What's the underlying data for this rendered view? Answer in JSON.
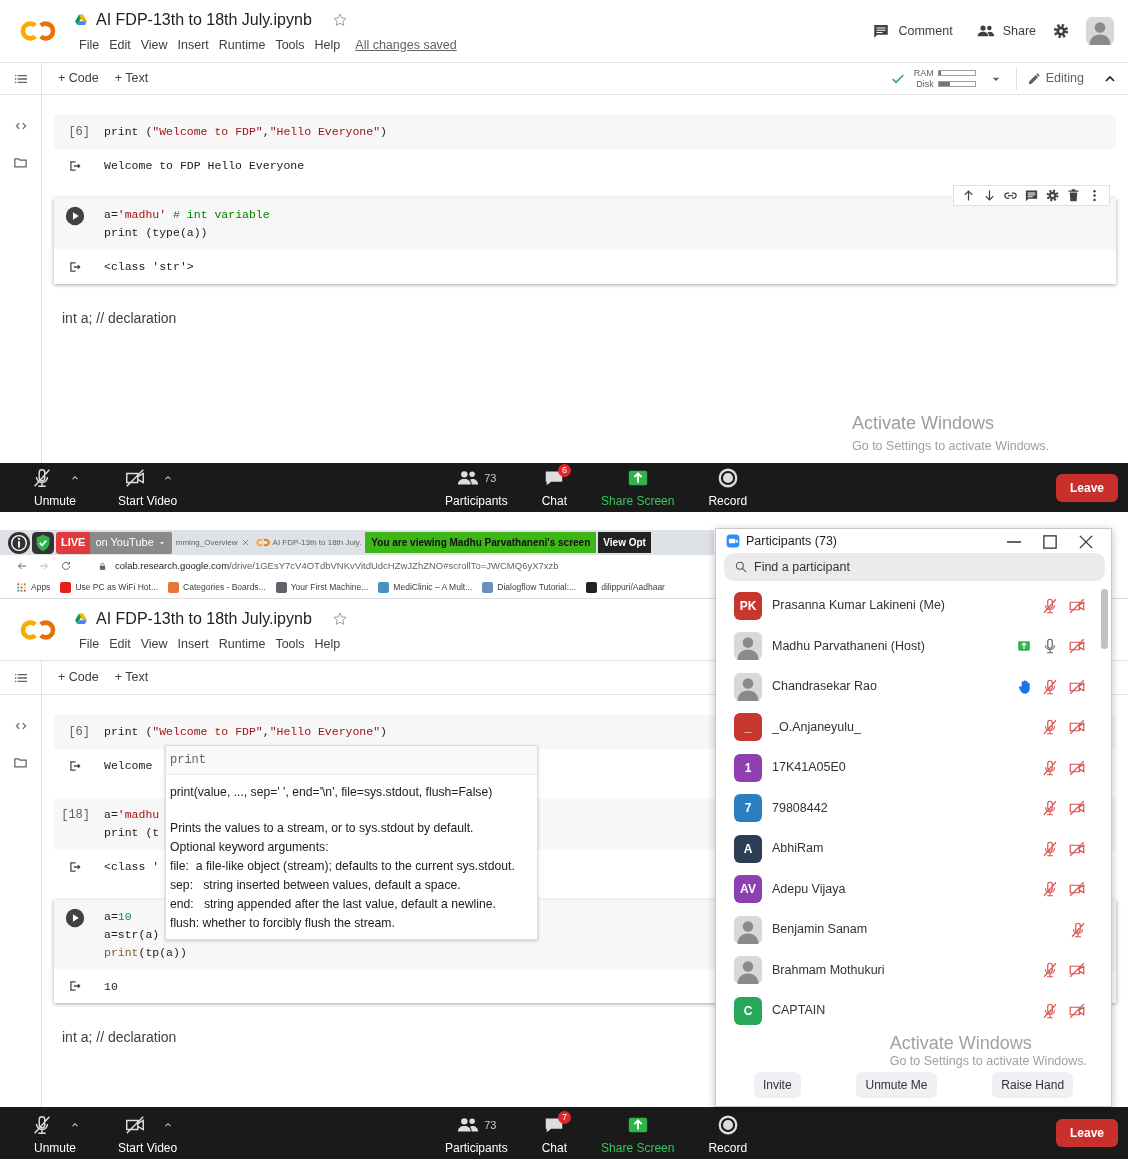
{
  "top_screen": {
    "notebook": {
      "title": "AI FDP-13th to 18th July.ipynb",
      "menu": [
        "File",
        "Edit",
        "View",
        "Insert",
        "Runtime",
        "Tools",
        "Help"
      ],
      "save_status": "All changes saved",
      "header_actions": [
        {
          "kind": "comment",
          "label": "Comment"
        },
        {
          "kind": "share",
          "label": "Share"
        }
      ],
      "toolbar": {
        "add_buttons": [
          "+ Code",
          "+ Text"
        ],
        "ram": {
          "label": "RAM",
          "level": 0.05
        },
        "disk": {
          "label": "Disk",
          "level": 0.3
        },
        "editing": "Editing"
      },
      "cells": [
        {
          "focused": false,
          "exec": "[6]",
          "lines": [
            [
              {
                "text": "print (",
                "kind": "plain"
              },
              {
                "text": "\"Welcome to FDP\"",
                "kind": "string"
              },
              {
                "text": ",",
                "kind": "plain"
              },
              {
                "text": "\"Hello Everyone\"",
                "kind": "string"
              },
              {
                "text": ")",
                "kind": "plain"
              }
            ]
          ],
          "output": "Welcome to FDP Hello Everyone"
        },
        {
          "focused": true,
          "toolbar": true,
          "lines": [
            [
              {
                "text": "a=",
                "kind": "plain"
              },
              {
                "text": "'madhu'",
                "kind": "string"
              },
              {
                "text": " # int variable",
                "kind": "comment"
              }
            ],
            [
              {
                "text": "print (type(a))",
                "kind": "plain"
              }
            ]
          ],
          "output": "<class 'str'>"
        }
      ],
      "text_cells": [
        "int a; // declaration"
      ]
    },
    "activation": {
      "title": "Activate Windows",
      "subtitle": "Go to Settings to activate Windows."
    },
    "meeting_toolbar": {
      "items": [
        {
          "kind": "mic",
          "label": "Unmute",
          "caret": true
        },
        {
          "kind": "video",
          "label": "Start Video",
          "caret": true
        },
        {
          "kind": "participants",
          "label": "Participants",
          "count": "73"
        },
        {
          "kind": "chat",
          "label": "Chat",
          "badge": "6"
        },
        {
          "kind": "share",
          "label": "Share Screen"
        },
        {
          "kind": "record",
          "label": "Record"
        }
      ],
      "leave": "Leave"
    }
  },
  "bottom_screen": {
    "overlay": {
      "live": "LIVE",
      "destination": "on YouTube"
    },
    "browser": {
      "tabs": [
        "mming_Overview",
        "AI FDP-13th to 18th July."
      ],
      "share_banner": "You are viewing Madhu Parvathaneni's screen",
      "view_options": "View Opt",
      "url_host": "colab.research.google.com",
      "url_path": "/drive/1GEsY7cV4OTdbVNKvVitdUdcHZwJZhZNO#scrollTo=JWCMQ6yX7xzb",
      "bookmarks": [
        {
          "label": "Apps"
        },
        {
          "label": "Use PC as WiFi Hot...",
          "color": "#e62117"
        },
        {
          "label": "Categories - Boards...",
          "color": "#e8743b"
        },
        {
          "label": "Your First Machine...",
          "color": "#5f6368"
        },
        {
          "label": "MediClinic – A Mult...",
          "color": "#4a90c2"
        },
        {
          "label": "Dialogflow Tutorial:...",
          "color": "#6b8fb8"
        },
        {
          "label": "dilippuri/Aadhaar",
          "color": "#222222"
        }
      ]
    },
    "notebook": {
      "title": "AI FDP-13th to 18th July.ipynb",
      "menu": [
        "File",
        "Edit",
        "View",
        "Insert",
        "Runtime",
        "Tools",
        "Help"
      ],
      "toolbar": {
        "add_buttons": [
          "+ Code",
          "+ Text"
        ]
      },
      "cells": [
        {
          "focused": false,
          "exec": "[6]",
          "lines": [
            [
              {
                "text": "print (",
                "kind": "plain"
              },
              {
                "text": "\"Welcome to FDP\"",
                "kind": "string"
              },
              {
                "text": ",",
                "kind": "plain"
              },
              {
                "text": "\"Hello Everyone\"",
                "kind": "string"
              },
              {
                "text": ")",
                "kind": "plain"
              }
            ]
          ],
          "output": "Welcome"
        },
        {
          "focused": false,
          "exec": "[18]",
          "lines": [
            [
              {
                "text": "a=",
                "kind": "plain"
              },
              {
                "text": "'madhu",
                "kind": "string"
              }
            ],
            [
              {
                "text": "print (t",
                "kind": "plain"
              }
            ]
          ],
          "output": "<class '"
        },
        {
          "focused": true,
          "lines": [
            [
              {
                "text": "a=",
                "kind": "plain"
              },
              {
                "text": "10",
                "kind": "number"
              }
            ],
            [
              {
                "text": "a=str(a)",
                "kind": "plain"
              }
            ],
            [
              {
                "text": "print",
                "kind": "builtin"
              },
              {
                "text": "(tp(a))",
                "kind": "plain"
              }
            ]
          ],
          "output": "10"
        }
      ],
      "text_cells": [
        "int a; // declaration"
      ],
      "tooltip": {
        "title": "print",
        "signature": "print(value, ..., sep=' ', end='\\n', file=sys.stdout, flush=False)",
        "doc": [
          "Prints the values to a stream, or to sys.stdout by default.",
          "Optional keyword arguments:",
          "file:  a file-like object (stream); defaults to the current sys.stdout.",
          "sep:   string inserted between values, default a space.",
          "end:   string appended after the last value, default a newline.",
          "flush: whether to forcibly flush the stream."
        ]
      }
    },
    "participants": {
      "title": "Participants (73)",
      "search_placeholder": "Find a participant",
      "list": [
        {
          "name": "Prasanna Kumar Lakineni (Me)",
          "avatar": {
            "kind": "initials",
            "text": "PK",
            "color": "#c8372d"
          },
          "mic_muted": true,
          "video_muted": true
        },
        {
          "name": "Madhu Parvathaneni (Host)",
          "avatar": {
            "kind": "photo"
          },
          "sharing": true,
          "mic_muted": false,
          "video_muted": true
        },
        {
          "name": "Chandrasekar Rao",
          "avatar": {
            "kind": "photo"
          },
          "hand_raised": true,
          "mic_muted": true,
          "video_muted": true
        },
        {
          "name": "_O.Anjaneyulu_",
          "avatar": {
            "kind": "initials",
            "text": "_",
            "color": "#c8372d"
          },
          "mic_muted": true,
          "video_muted": true
        },
        {
          "name": "17K41A05E0",
          "avatar": {
            "kind": "initials",
            "text": "1",
            "color": "#8e3fb0"
          },
          "mic_muted": true,
          "video_muted": true
        },
        {
          "name": "79808442",
          "avatar": {
            "kind": "initials",
            "text": "7",
            "color": "#2a7fc1"
          },
          "mic_muted": true,
          "video_muted": true
        },
        {
          "name": "AbhiRam",
          "avatar": {
            "kind": "initials",
            "text": "A",
            "color": "#2c3e56"
          },
          "mic_muted": true,
          "video_muted": true
        },
        {
          "name": "Adepu Vijaya",
          "avatar": {
            "kind": "initials",
            "text": "AV",
            "color": "#8e3fb0"
          },
          "mic_muted": true,
          "video_muted": true
        },
        {
          "name": "Benjamin Sanam",
          "avatar": {
            "kind": "photo"
          },
          "mic_muted": true
        },
        {
          "name": "Brahmam Mothukuri",
          "avatar": {
            "kind": "photo"
          },
          "mic_muted": true,
          "video_muted": true
        },
        {
          "name": "CAPTAIN",
          "avatar": {
            "kind": "initials",
            "text": "C",
            "color": "#27a85a"
          },
          "mic_muted": true,
          "video_muted": true
        }
      ],
      "buttons": [
        "Invite",
        "Unmute Me",
        "Raise Hand"
      ]
    },
    "activation": {
      "title": "Activate Windows",
      "subtitle": "Go to Settings to activate Windows."
    },
    "meeting_toolbar": {
      "items": [
        {
          "kind": "mic",
          "label": "Unmute",
          "caret": true
        },
        {
          "kind": "video",
          "label": "Start Video",
          "caret": true
        },
        {
          "kind": "participants",
          "label": "Participants",
          "count": "73"
        },
        {
          "kind": "chat",
          "label": "Chat",
          "badge": "7"
        },
        {
          "kind": "share",
          "label": "Share Screen"
        },
        {
          "kind": "record",
          "label": "Record"
        }
      ],
      "leave": "Leave"
    }
  }
}
